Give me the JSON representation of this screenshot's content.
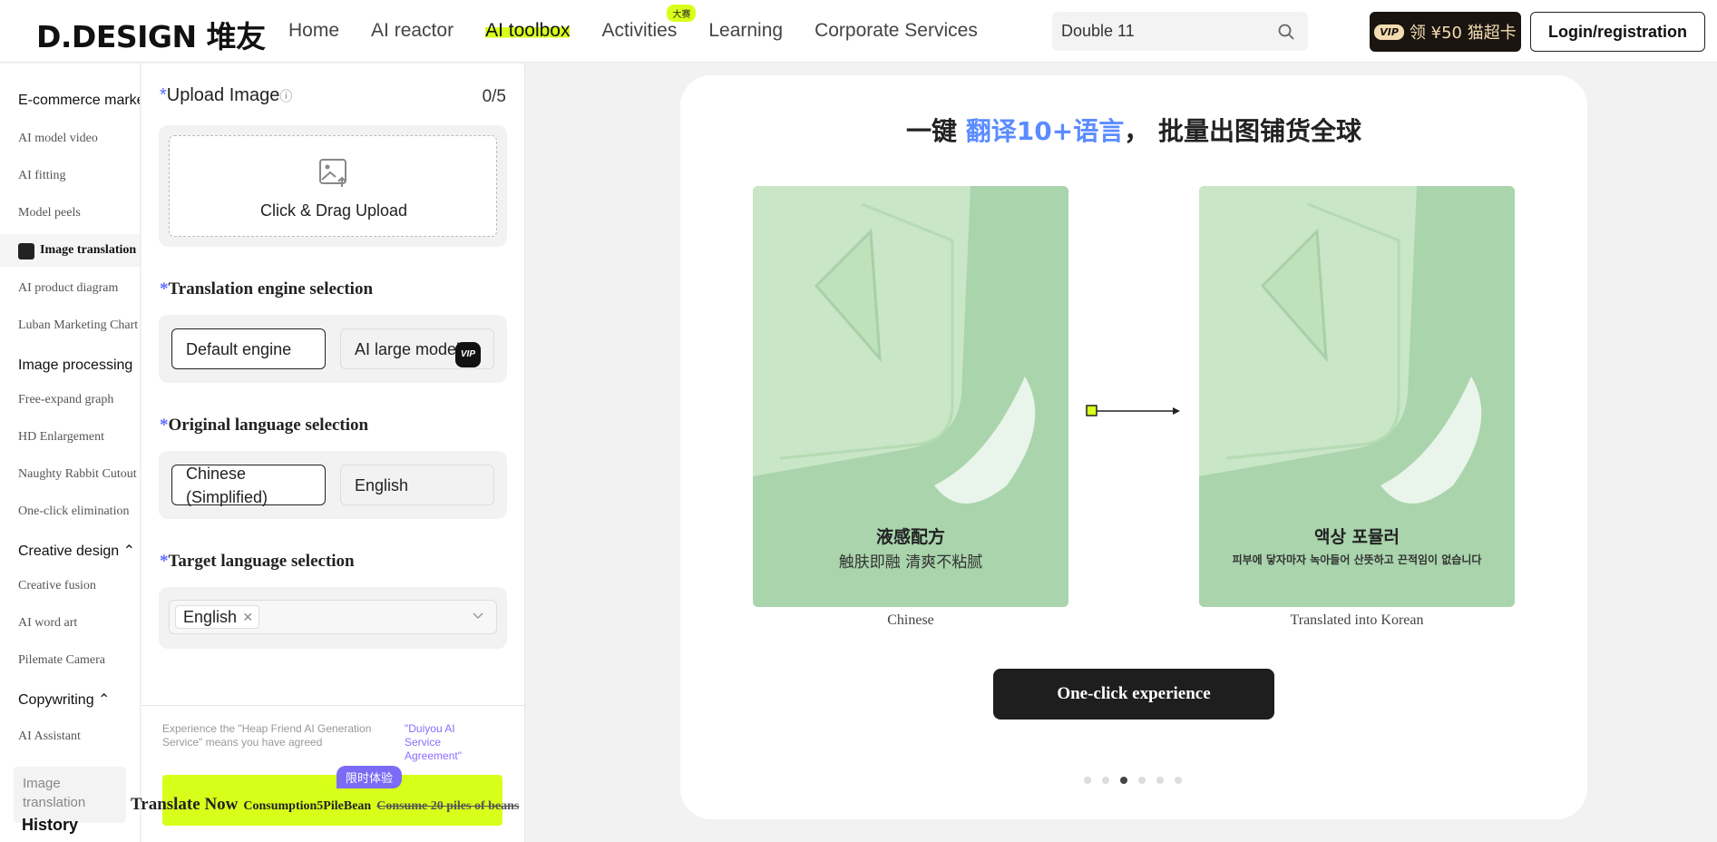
{
  "header": {
    "logo": "D.DESIGN 堆友",
    "nav": [
      {
        "label": "Home"
      },
      {
        "label": "AI reactor"
      },
      {
        "label": "AI toolbox",
        "active": true
      },
      {
        "label": "Activities",
        "badge": "大赛"
      },
      {
        "label": "Learning"
      },
      {
        "label": "Corporate Services"
      }
    ],
    "search_value": "Double 11",
    "vip_tag": "VIP",
    "vip_label": "领 ¥50 猫超卡",
    "login_label": "Login/registration"
  },
  "sidebar": {
    "items": [
      {
        "label": "E-commerce marketing",
        "type": "group"
      },
      {
        "label": "AI model video"
      },
      {
        "label": "AI fitting"
      },
      {
        "label": "Model peels"
      },
      {
        "label": "Image translation",
        "active": true
      },
      {
        "label": "AI product diagram"
      },
      {
        "label": "Luban Marketing Chart"
      },
      {
        "label": "Image processing",
        "type": "group"
      },
      {
        "label": "Free-expand graph"
      },
      {
        "label": "HD Enlargement"
      },
      {
        "label": "Naughty Rabbit Cutout"
      },
      {
        "label": "One-click elimination"
      },
      {
        "label": "Creative design",
        "type": "group"
      },
      {
        "label": "Creative fusion"
      },
      {
        "label": "AI word art"
      },
      {
        "label": "Pilemate Camera"
      },
      {
        "label": "Copywriting",
        "type": "group"
      },
      {
        "label": "AI Assistant"
      }
    ],
    "history_box": "Image translation",
    "history_label": "History"
  },
  "panel": {
    "upload_title": "Upload Image",
    "upload_count": "0/5",
    "upload_label": "Click & Drag Upload",
    "engine_title": "Translation engine selection",
    "engine_options": [
      "Default engine",
      "AI large model"
    ],
    "engine_vip": "VIP",
    "orig_title": "Original language selection",
    "orig_options": [
      "Chinese (Simplified)",
      "English"
    ],
    "target_title": "Target language selection",
    "target_value": "English",
    "agree_text": "Experience the \"Heap Friend AI Generation Service\" means you have agreed",
    "agree_link": "\"Duiyou AI Service Agreement\"",
    "limited_badge": "限时体验",
    "translate_label": "Translate Now",
    "translate_cost": "Consumption5PileBean",
    "translate_strike": "Consume 20 piles of beans"
  },
  "main": {
    "title_prefix": "一键 ",
    "title_highlight": "翻译10+语言",
    "title_suffix": "， 批量出图铺货全球",
    "left_caption_title": "液感配方",
    "left_caption_sub": "触肤即融 清爽不粘腻",
    "right_caption_title": "액상 포뮬러",
    "right_caption_sub": "피부에 닿자마자 녹아들어 산뜻하고 끈적임이 없습니다",
    "left_label": "Chinese",
    "right_label": "Translated into Korean",
    "cta": "One-click experience",
    "slides": 6,
    "active_slide": 3
  },
  "colors": {
    "accent": "#d8ff1a",
    "dark": "#1e1e1e",
    "purple": "#7c6cf5",
    "product_bg": "#a8d3aa"
  }
}
